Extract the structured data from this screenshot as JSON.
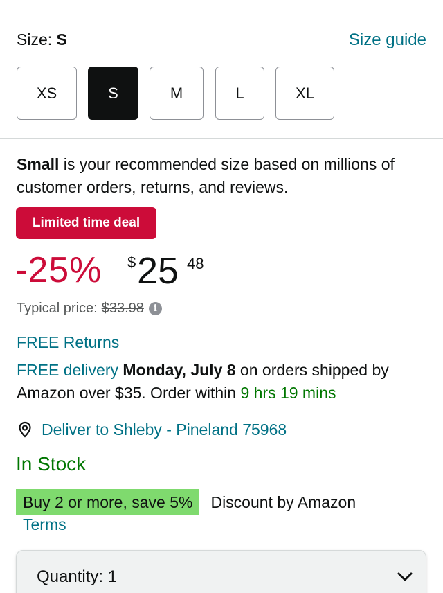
{
  "size": {
    "label_prefix": "Size:",
    "selected": "S",
    "guide_link": "Size guide",
    "options": [
      "XS",
      "S",
      "M",
      "L",
      "XL"
    ],
    "selected_index": 1
  },
  "recommendation": {
    "bold": "Small",
    "text": " is your recommended size based on millions of customer orders, returns, and reviews."
  },
  "deal": {
    "badge": "Limited time deal",
    "discount": "-25%",
    "currency": "$",
    "price_whole": "25",
    "price_fraction": "48",
    "typical_label": "Typical price:",
    "typical_price": "$33.98",
    "info_icon": "info-icon"
  },
  "shipping": {
    "free_returns": "FREE Returns",
    "free_delivery": "FREE delivery",
    "date": "Monday, July 8",
    "condition": " on orders shipped by Amazon over $35. Order within ",
    "countdown": "9 hrs 19 mins"
  },
  "location": {
    "icon": "location-pin-icon",
    "text": "Deliver to Shleby - Pineland 75968"
  },
  "stock": "In Stock",
  "promotion": {
    "badge": "Buy 2 or more, save 5%",
    "note": "Discount by Amazon",
    "terms": "Terms"
  },
  "quantity": {
    "label": "Quantity:",
    "value": "1",
    "icon": "chevron-down-icon"
  },
  "colors": {
    "link": "#007185",
    "deal_red": "#cc0c39",
    "stock_green": "#007600",
    "promo_green": "#7fda6e",
    "text": "#0f1111"
  }
}
